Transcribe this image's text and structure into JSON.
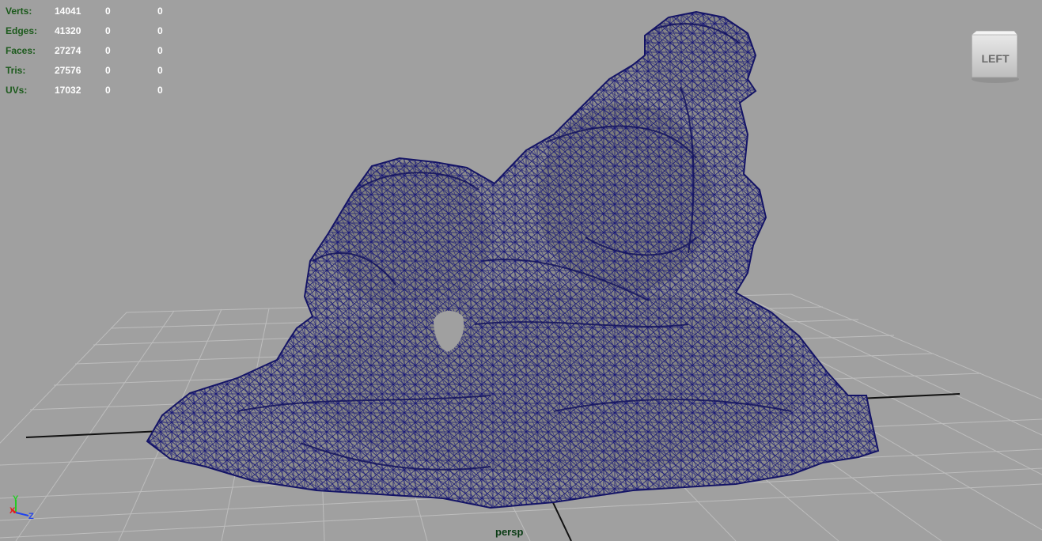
{
  "hud": {
    "rows": [
      {
        "label": "Verts:",
        "total": "14041",
        "selected": "0",
        "component": "0"
      },
      {
        "label": "Edges:",
        "total": "41320",
        "selected": "0",
        "component": "0"
      },
      {
        "label": "Faces:",
        "total": "27274",
        "selected": "0",
        "component": "0"
      },
      {
        "label": "Tris:",
        "total": "27576",
        "selected": "0",
        "component": "0"
      },
      {
        "label": "UVs:",
        "total": "17032",
        "selected": "0",
        "component": "0"
      }
    ]
  },
  "view_cube": {
    "face_label": "LEFT",
    "icon": "view-cube-icon"
  },
  "camera": {
    "name": "persp"
  },
  "axis_gizmo": {
    "y_label": "Y",
    "x_label": "X",
    "z_label": "Z",
    "icon": "axis-orientation-icon"
  },
  "colors": {
    "viewport_background": "#a0a0a0",
    "grid_line": "#bdbdbd",
    "grid_axis": "#000000",
    "mesh_fill": "#8c8c8c",
    "wireframe": "#1a1a78",
    "hud_label": "#1c5a1c",
    "hud_value": "#ffffff",
    "axis_x": "#e02020",
    "axis_y": "#22cc22",
    "axis_z": "#2244ee"
  }
}
